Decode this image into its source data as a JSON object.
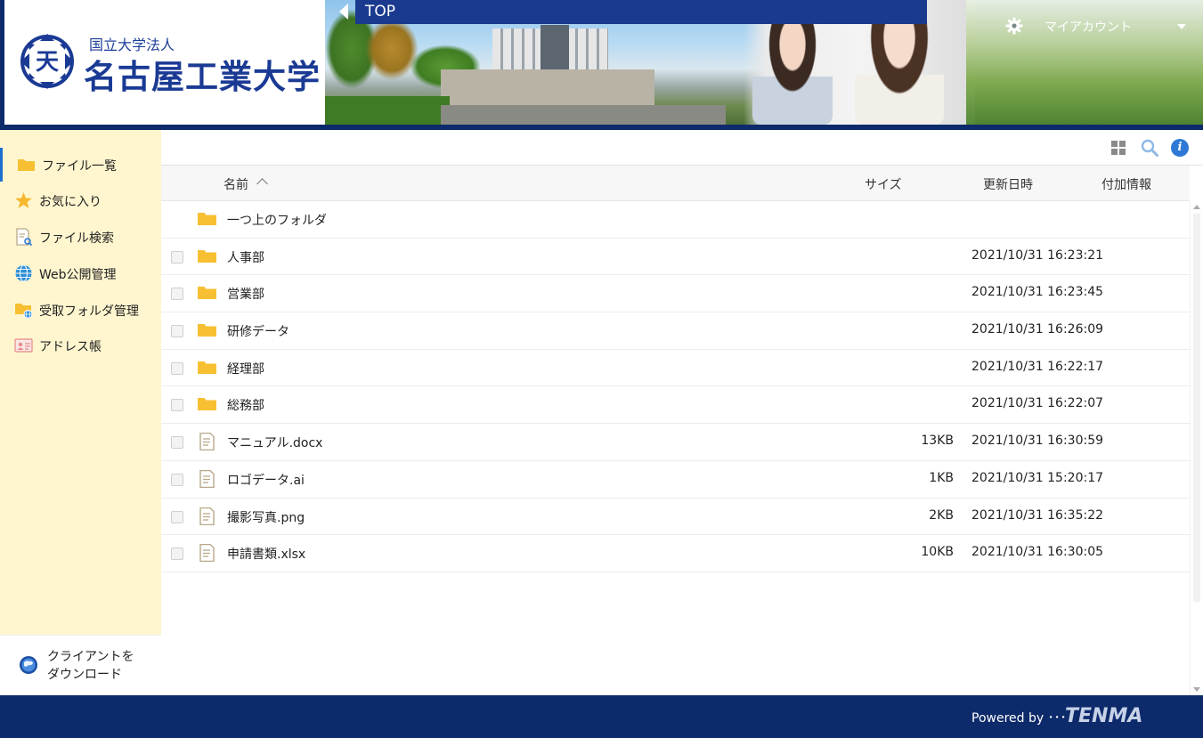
{
  "header": {
    "logo_sub": "国立大学法人",
    "logo_main": "名古屋工業大学",
    "emblem_text": "天",
    "breadcrumb": "TOP",
    "account_label": "マイアカウント"
  },
  "sidebar": {
    "items": [
      {
        "label": "ファイル一覧",
        "icon": "folder-icon"
      },
      {
        "label": "お気に入り",
        "icon": "star-icon"
      },
      {
        "label": "ファイル検索",
        "icon": "file-search-icon"
      },
      {
        "label": "Web公開管理",
        "icon": "globe-icon"
      },
      {
        "label": "受取フォルダ管理",
        "icon": "folder-globe-icon"
      },
      {
        "label": "アドレス帳",
        "icon": "address-card-icon"
      }
    ],
    "client_download": "クライアントを\nダウンロード"
  },
  "table": {
    "columns": {
      "name": "名前",
      "size": "サイズ",
      "modified": "更新日時",
      "extra": "付加情報"
    },
    "rows": [
      {
        "type": "parent",
        "name": "一つ上のフォルダ",
        "size": "",
        "modified": ""
      },
      {
        "type": "folder",
        "name": "人事部",
        "size": "",
        "modified": "2021/10/31 16:23:21"
      },
      {
        "type": "folder",
        "name": "営業部",
        "size": "",
        "modified": "2021/10/31 16:23:45"
      },
      {
        "type": "folder",
        "name": "研修データ",
        "size": "",
        "modified": "2021/10/31 16:26:09"
      },
      {
        "type": "folder",
        "name": "経理部",
        "size": "",
        "modified": "2021/10/31 16:22:17"
      },
      {
        "type": "folder",
        "name": "総務部",
        "size": "",
        "modified": "2021/10/31 16:22:07"
      },
      {
        "type": "file",
        "name": "マニュアル.docx",
        "size": "13KB",
        "modified": "2021/10/31 16:30:59"
      },
      {
        "type": "file",
        "name": "ロゴデータ.ai",
        "size": "1KB",
        "modified": "2021/10/31 15:20:17"
      },
      {
        "type": "file",
        "name": "撮影写真.png",
        "size": "2KB",
        "modified": "2021/10/31 16:35:22"
      },
      {
        "type": "file",
        "name": "申請書類.xlsx",
        "size": "10KB",
        "modified": "2021/10/31 16:30:05"
      }
    ]
  },
  "footer": {
    "powered_by": "Powered by ･･･",
    "brand": "TENMA"
  },
  "colors": {
    "navy": "#0d2a6b",
    "sidebar_bg": "#fff6cf",
    "folder": "#f7c033",
    "accent_blue": "#2f79d6"
  }
}
